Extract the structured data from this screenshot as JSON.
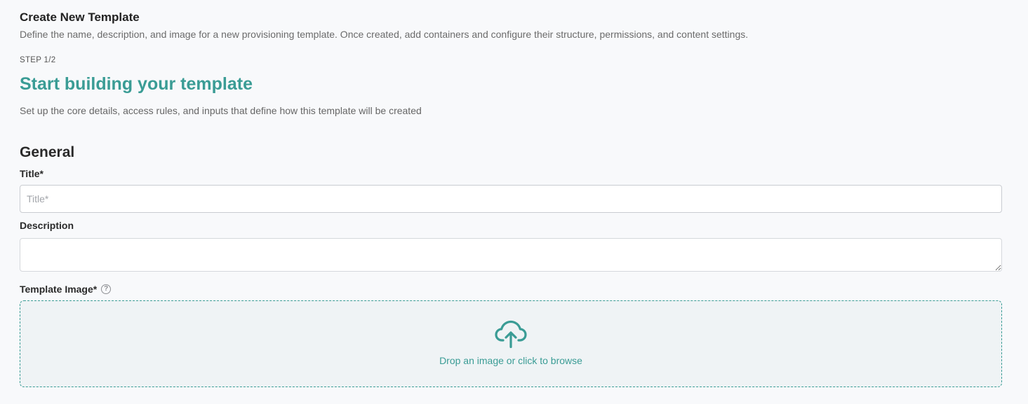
{
  "header": {
    "title": "Create New Template",
    "description": "Define the name, description, and image for a new provisioning template. Once created, add containers and configure their structure, permissions, and content settings."
  },
  "step": {
    "label": "STEP 1/2",
    "title": "Start building your template",
    "description": "Set up the core details, access rules, and inputs that define how this template will be created"
  },
  "general": {
    "section_title": "General",
    "title_field": {
      "label": "Title*",
      "placeholder": "Title*",
      "value": ""
    },
    "description_field": {
      "label": "Description",
      "value": ""
    },
    "image_field": {
      "label": "Template Image*",
      "help_icon": "question-circle-icon",
      "help_glyph": "?",
      "upload_icon": "cloud-upload-icon",
      "dropzone_text": "Drop an image or click to browse"
    }
  },
  "colors": {
    "accent": "#3a9c95",
    "background": "#f8f9fb",
    "dropzone_bg": "#eff3f5"
  }
}
